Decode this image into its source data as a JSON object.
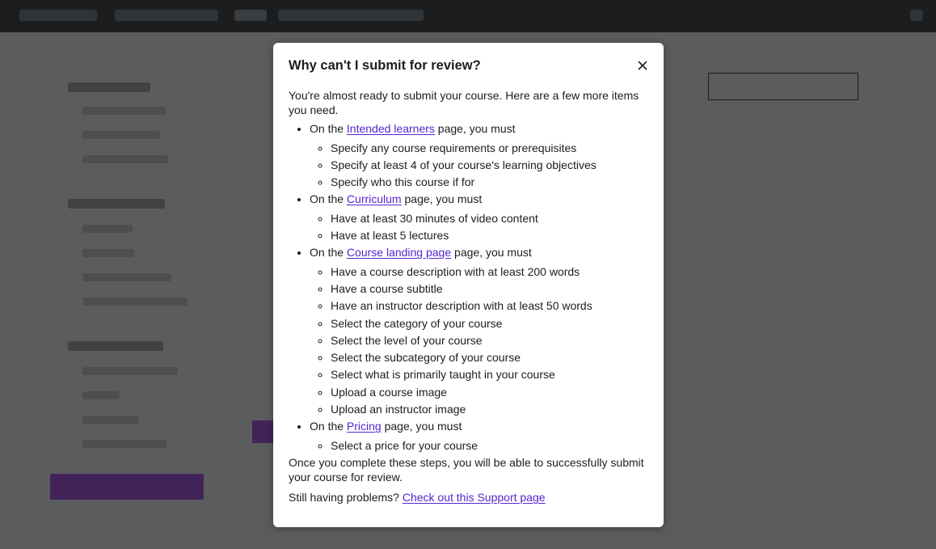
{
  "modal": {
    "title": "Why can't I submit for review?",
    "intro": "You're almost ready to submit your course. Here are a few more items you need.",
    "sections": [
      {
        "prefix": "On the ",
        "link": "Intended learners",
        "suffix": " page, you must",
        "items": [
          "Specify any course requirements or prerequisites",
          "Specify at least 4 of your course's learning objectives",
          "Specify who this course if for"
        ]
      },
      {
        "prefix": "On the ",
        "link": "Curriculum",
        "suffix": " page, you must",
        "items": [
          "Have at least 30 minutes of video content",
          "Have at least 5 lectures"
        ]
      },
      {
        "prefix": "On the ",
        "link": "Course landing page",
        "suffix": " page, you must",
        "items": [
          "Have a course description with at least 200 words",
          "Have a course subtitle",
          "Have an instructor description with at least 50 words",
          "Select the category of your course",
          "Select the level of your course",
          "Select the subcategory of your course",
          "Select what is primarily taught in your course",
          "Upload a course image",
          "Upload an instructor image"
        ]
      },
      {
        "prefix": "On the ",
        "link": "Pricing",
        "suffix": " page, you must",
        "items": [
          "Select a price for your course"
        ]
      }
    ],
    "outro": "Once you complete these steps, you will be able to successfully submit your course for review.",
    "help_prefix": "Still having problems? ",
    "help_link": "Check out this Support page",
    "close_icon": "close-icon"
  },
  "colors": {
    "link": "#5624d0",
    "overlay": "rgba(28,29,31,0.72)",
    "accent": "#a435f0"
  }
}
